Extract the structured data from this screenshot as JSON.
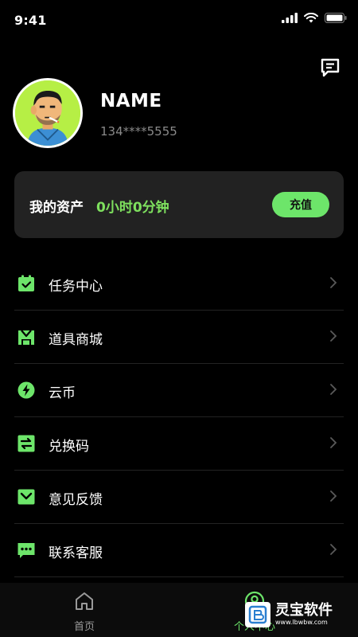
{
  "status_bar": {
    "time": "9:41",
    "icons": [
      "signal-icon",
      "wifi-icon",
      "battery-icon"
    ]
  },
  "header": {
    "icon": "message-icon"
  },
  "profile": {
    "avatar": "avatar",
    "name": "NAME",
    "phone": "134****5555"
  },
  "assets": {
    "label": "我的资产",
    "value": "0小时0分钟",
    "button_label": "充值"
  },
  "menu": {
    "items": [
      {
        "label": "任务中心",
        "icon": "task-icon"
      },
      {
        "label": "道具商城",
        "icon": "store-icon"
      },
      {
        "label": "云币",
        "icon": "coin-icon"
      },
      {
        "label": "兑换码",
        "icon": "exchange-icon"
      },
      {
        "label": "意见反馈",
        "icon": "feedback-icon"
      },
      {
        "label": "联系客服",
        "icon": "service-icon"
      }
    ]
  },
  "bottom_nav": {
    "items": [
      {
        "label": "首页",
        "icon": "home-icon",
        "active": false
      },
      {
        "label": "个人中心",
        "icon": "profile-icon",
        "active": true
      }
    ]
  },
  "watermark": {
    "title": "灵宝软件",
    "subtitle": "www.lbwbw.com"
  },
  "colors": {
    "background": "#000000",
    "accent": "#6de56a",
    "card": "#222222",
    "muted": "#8a8a8a"
  }
}
